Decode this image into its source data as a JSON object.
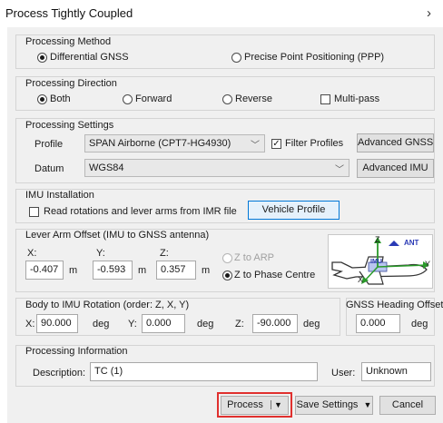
{
  "window": {
    "title": "Process Tightly Coupled",
    "close_glyph": "›"
  },
  "processing_method": {
    "label": "Processing Method",
    "options": [
      "Differential GNSS",
      "Precise Point Positioning (PPP)"
    ],
    "selected": "Differential GNSS"
  },
  "processing_direction": {
    "label": "Processing Direction",
    "options": [
      "Both",
      "Forward",
      "Reverse"
    ],
    "selected": "Both",
    "multipass_label": "Multi-pass",
    "multipass_checked": false
  },
  "processing_settings": {
    "label": "Processing Settings",
    "profile_label": "Profile",
    "profile_value": "SPAN Airborne (CPT7-HG4930)",
    "filter_profiles_label": "Filter Profiles",
    "filter_profiles_checked": true,
    "advanced_gnss_label": "Advanced GNSS",
    "datum_label": "Datum",
    "datum_value": "WGS84",
    "advanced_imu_label": "Advanced IMU"
  },
  "imu_installation": {
    "label": "IMU Installation",
    "read_label": "Read rotations and lever arms from IMR file",
    "read_checked": false,
    "vehicle_profile_label": "Vehicle Profile"
  },
  "lever_arm": {
    "label": "Lever Arm Offset (IMU to GNSS antenna)",
    "x_label": "X:",
    "x_value": "-0.407",
    "y_label": "Y:",
    "y_value": "-0.593",
    "z_label": "Z:",
    "z_value": "0.357",
    "unit": "m",
    "z_arp_label": "Z to ARP",
    "z_phase_label": "Z to Phase Centre",
    "z_selected": "Z to Phase Centre",
    "diagram": {
      "z": "Z",
      "ant": "ANT",
      "imu": "IMU",
      "y": "Y",
      "x": "X"
    }
  },
  "body_rotation": {
    "label": "Body to IMU Rotation (order: Z, X, Y)",
    "x_label": "X:",
    "x_value": "90.000",
    "y_label": "Y:",
    "y_value": "0.000",
    "z_label": "Z:",
    "z_value": "-90.000",
    "unit": "deg"
  },
  "heading_offset": {
    "label": "GNSS Heading Offset",
    "value": "0.000",
    "unit": "deg"
  },
  "processing_info": {
    "label": "Processing Information",
    "description_label": "Description:",
    "description_value": "TC (1)",
    "user_label": "User:",
    "user_value": "Unknown"
  },
  "buttons": {
    "process": "Process",
    "save_settings": "Save Settings",
    "cancel": "Cancel"
  },
  "colors": {
    "accent": "#0078d7",
    "highlight": "#e0302e",
    "ant": "#2a3ab5",
    "green": "#2a9a2a"
  }
}
